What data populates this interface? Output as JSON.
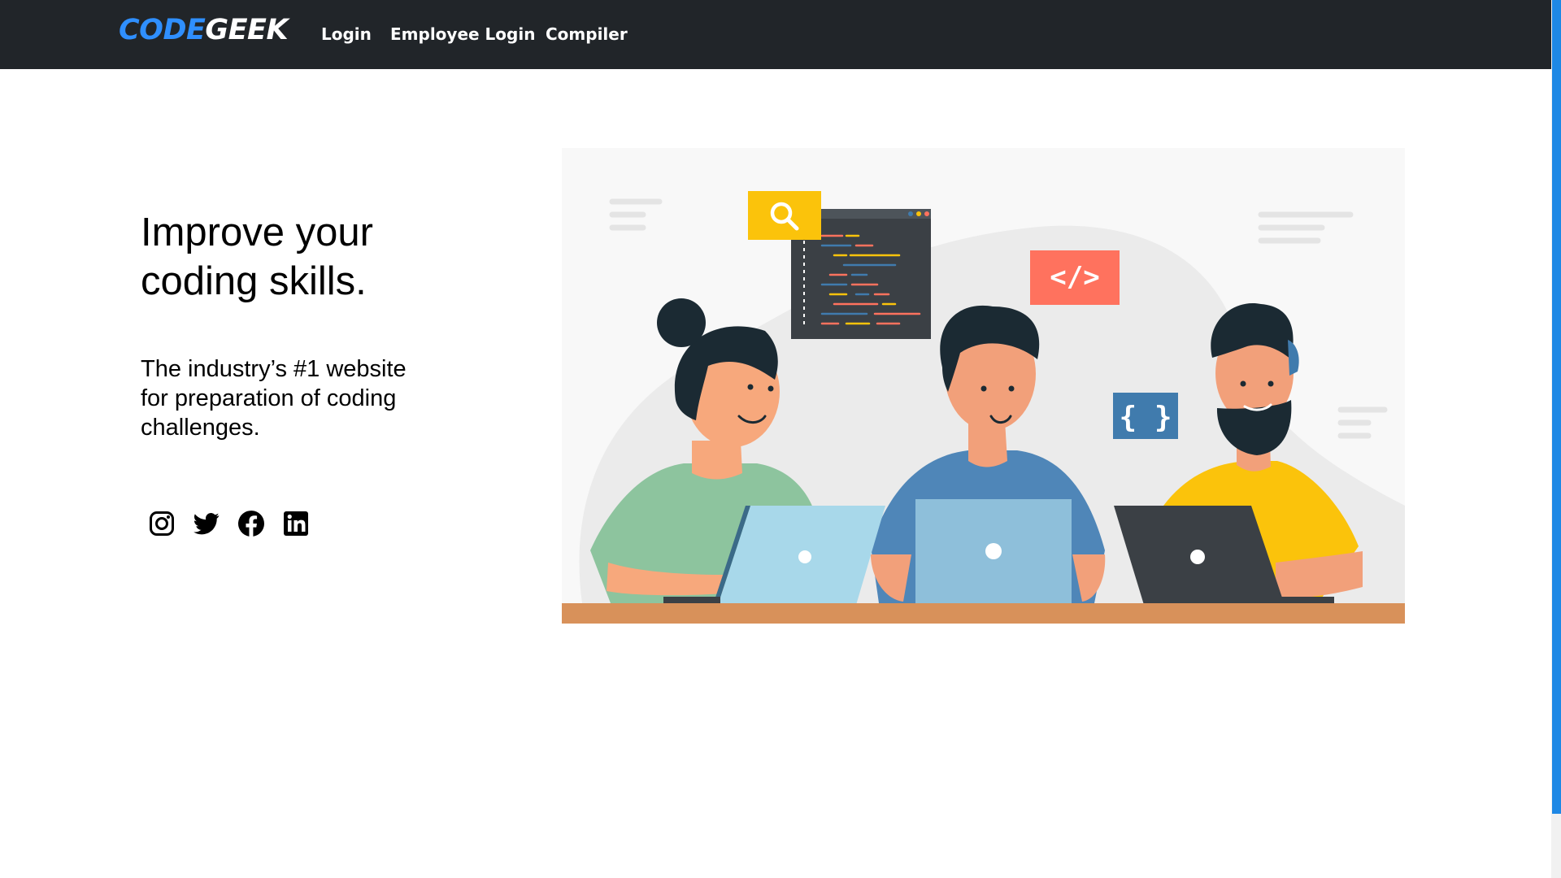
{
  "navbar": {
    "brand_part1": "CODE",
    "brand_part2": "GEEK",
    "links": [
      "Login",
      "Employee Login",
      "Compiler"
    ]
  },
  "hero": {
    "title": "Improve your coding skills.",
    "subtitle": "The industry’s #1 website for preparation of coding challenges."
  },
  "social": {
    "icons": [
      "instagram-icon",
      "twitter-icon",
      "facebook-icon",
      "linkedin-icon"
    ]
  },
  "illustration": {
    "code_tag_text": "</>",
    "braces_text": "{ }"
  },
  "colors": {
    "navbar_bg": "#212529",
    "brand_accent": "#2f8fff",
    "scrollbar_thumb": "#1e88e5",
    "search_badge": "#fbc30b",
    "code_badge": "#ff725e",
    "braces_badge": "#407bad"
  }
}
